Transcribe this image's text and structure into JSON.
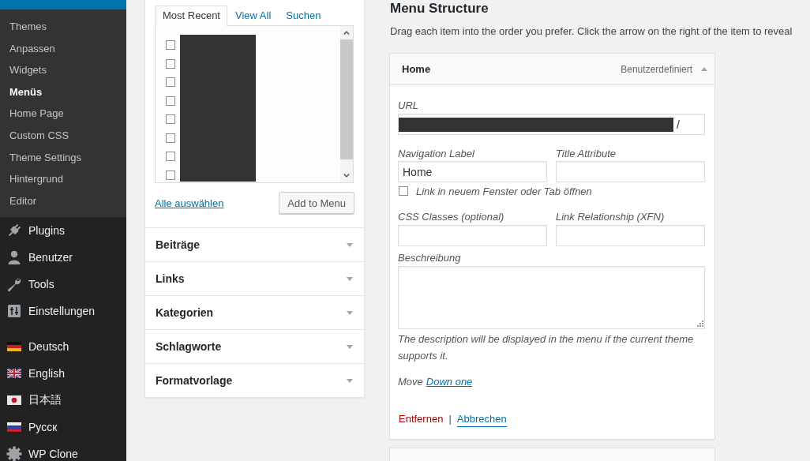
{
  "sidebar": {
    "menu": [
      {
        "selected": true,
        "submenu": [
          {
            "label": "Themes",
            "selected": false
          },
          {
            "label": "Anpassen",
            "selected": false
          },
          {
            "label": "Widgets",
            "selected": false
          },
          {
            "label": "Menüs",
            "selected": true
          },
          {
            "label": "Home Page",
            "selected": false
          },
          {
            "label": "Custom CSS",
            "selected": false
          },
          {
            "label": "Theme Settings",
            "selected": false
          },
          {
            "label": "Hintergrund",
            "selected": false
          },
          {
            "label": "Editor",
            "selected": false
          }
        ]
      },
      {
        "label": "Plugins",
        "selected": false
      },
      {
        "label": "Benutzer",
        "selected": false
      },
      {
        "label": "Tools",
        "selected": false
      },
      {
        "label": "Einstellungen",
        "selected": false
      }
    ],
    "menu_lower": [
      {
        "label": "Deutsch",
        "selected": false
      },
      {
        "label": "English",
        "selected": false
      },
      {
        "label": "日本語",
        "selected": false
      },
      {
        "label": "Русск",
        "selected": false
      },
      {
        "label": "WP Clone",
        "selected": false
      }
    ]
  },
  "pages_box": {
    "tabs": [
      {
        "label": "Most Recent",
        "selected": true
      },
      {
        "label": "View All",
        "selected": false
      },
      {
        "label": "Suchen",
        "selected": false
      }
    ],
    "items": [
      {
        "checked": false
      },
      {
        "checked": false
      },
      {
        "checked": false
      },
      {
        "checked": false
      },
      {
        "checked": false
      },
      {
        "checked": false
      },
      {
        "checked": false
      },
      {
        "checked": false
      }
    ],
    "labels_redacted": true,
    "select_all": "Alle auswählen",
    "add_button": "Add to Menu"
  },
  "sections": [
    {
      "label": "Beiträge",
      "expanded": false
    },
    {
      "label": "Links",
      "expanded": false
    },
    {
      "label": "Kategorien",
      "expanded": false
    },
    {
      "label": "Schlagworte",
      "expanded": false
    },
    {
      "label": "Formatvorlage",
      "expanded": false
    }
  ],
  "menu_structure": {
    "title": "Menu Structure",
    "description": "Drag each item into the order you prefer. Click the arrow on the right of the item to reveal",
    "items": [
      {
        "title": "Home",
        "type_label": "Benutzerdefiniert",
        "expanded": true,
        "url": {
          "label": "URL",
          "value": "/",
          "redacted": true
        },
        "navigation_label": {
          "label": "Navigation Label",
          "value": "Home"
        },
        "title_attribute": {
          "label": "Title Attribute"
        },
        "new_tab": {
          "label": "Link in neuem Fenster oder Tab öffnen",
          "checked": false
        },
        "css_classes": {
          "label": "CSS Classes (optional)"
        },
        "link_relationship": {
          "label": "Link Relationship (XFN)"
        },
        "description": {
          "label": "Beschreibung"
        },
        "description_help": "The description will be displayed in the menu if the current theme supports it.",
        "move": {
          "label": "Move",
          "link": "Down one"
        },
        "remove": "Entfernen",
        "separator": "|",
        "cancel": "Abbrechen"
      }
    ],
    "more_items_below": true
  }
}
